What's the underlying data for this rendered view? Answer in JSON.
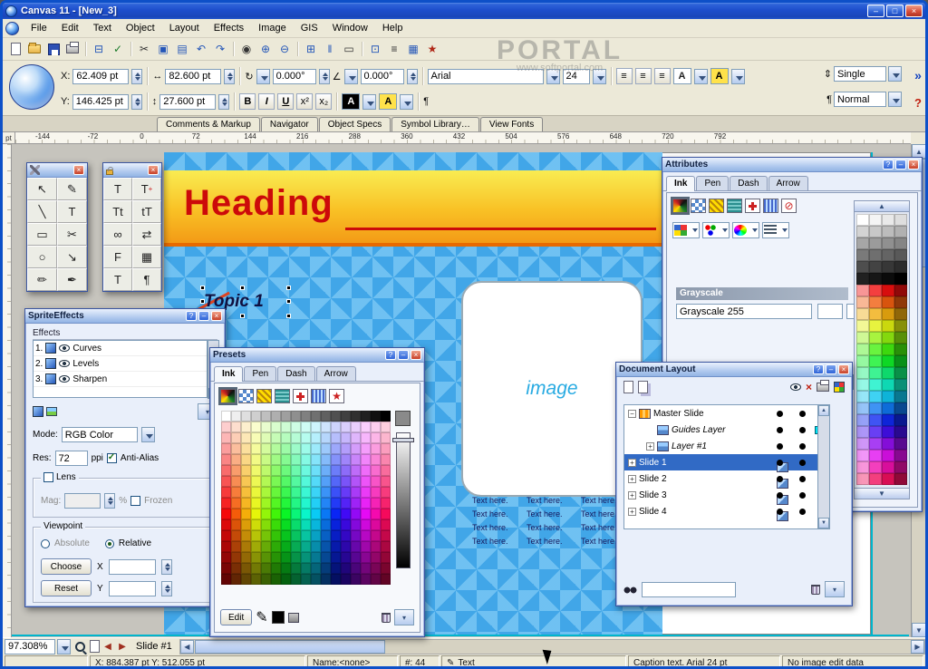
{
  "window": {
    "title": "Canvas 11 - [New_3]"
  },
  "menubar": {
    "items": [
      "File",
      "Edit",
      "Text",
      "Object",
      "Layout",
      "Effects",
      "Image",
      "GIS",
      "Window",
      "Help"
    ]
  },
  "watermark": {
    "line1": "PORTAL",
    "line2": "www.softportal.com"
  },
  "icons": {
    "dropdown": "▾",
    "left": "◀",
    "right": "▶",
    "up": "▲",
    "down": "▼",
    "help": "?",
    "close": "×",
    "minimize": "–",
    "restore": "□",
    "pen": "✎",
    "width_arrow": "↔",
    "height_arrow": "↕",
    "rotate": "↻",
    "slant": "∠",
    "chevron": "»",
    "question": "?",
    "paragraph": "¶",
    "spacing": "⇕",
    "redx": "×"
  },
  "toolbar": {
    "icons": [
      {
        "name": "new-document-icon",
        "kind": "mi-page",
        "glyph": ""
      },
      {
        "name": "open-icon",
        "kind": "mi-folder",
        "glyph": ""
      },
      {
        "name": "save-icon",
        "kind": "mi-disk",
        "glyph": ""
      },
      {
        "name": "print-icon",
        "kind": "mi-printer",
        "glyph": ""
      },
      {
        "name": "separator",
        "cls": "sep",
        "glyph": ""
      },
      {
        "name": "page-setup-icon",
        "glyph": "⊟",
        "gcls": "blue"
      },
      {
        "name": "spell-check-icon",
        "glyph": "✓",
        "gcls": "green"
      },
      {
        "name": "separator",
        "cls": "sep",
        "glyph": ""
      },
      {
        "name": "cut-icon",
        "glyph": "✂"
      },
      {
        "name": "copy-icon",
        "glyph": "▣",
        "gcls": "blue"
      },
      {
        "name": "paste-icon",
        "glyph": "▤",
        "gcls": "blue"
      },
      {
        "name": "undo-icon",
        "glyph": "↶",
        "gcls": "blue"
      },
      {
        "name": "redo-icon",
        "glyph": "↷",
        "gcls": "blue"
      },
      {
        "name": "separator",
        "cls": "sep",
        "glyph": ""
      },
      {
        "name": "find-icon",
        "glyph": "◉"
      },
      {
        "name": "zoom-in-icon",
        "glyph": "⊕",
        "gcls": "blue"
      },
      {
        "name": "zoom-out-icon",
        "glyph": "⊖",
        "gcls": "blue"
      },
      {
        "name": "separator",
        "cls": "sep",
        "glyph": ""
      },
      {
        "name": "grid-icon",
        "glyph": "⊞",
        "gcls": "blue"
      },
      {
        "name": "guides-icon",
        "glyph": "‖",
        "gcls": "blue"
      },
      {
        "name": "rulers-icon",
        "glyph": "▭"
      },
      {
        "name": "separator",
        "cls": "sep",
        "glyph": ""
      },
      {
        "name": "group-icon",
        "glyph": "⊡",
        "gcls": "blue"
      },
      {
        "name": "align-icon",
        "glyph": "≡"
      },
      {
        "name": "table-icon",
        "glyph": "▦",
        "gcls": "blue"
      },
      {
        "name": "symbol-icon",
        "glyph": "★",
        "gcls": "red"
      }
    ]
  },
  "propbar": {
    "x_label": "X:",
    "x_value": "62.409 pt",
    "y_label": "Y:",
    "y_value": "146.425 pt",
    "width_value": "82.600 pt",
    "height_value": "27.600 pt",
    "rotation_value": "0.000°",
    "skew_value": "0.000°",
    "font_family": "Arial",
    "font_size": "24",
    "bold": "B",
    "italic": "I",
    "underline": "U",
    "superscript": "x²",
    "subscript": "x₂",
    "color_letter": "A",
    "paragraph_style": "Single",
    "text_style": "Normal"
  },
  "dock_tabs": {
    "items": [
      "Comments & Markup",
      "Navigator",
      "Object Specs",
      "Symbol Library…",
      "View Fonts"
    ]
  },
  "ruler": {
    "unit_label": "pt",
    "numbers": [
      "-144",
      "-72",
      "0",
      "72",
      "144",
      "216",
      "288",
      "360",
      "432",
      "504",
      "576",
      "648",
      "720",
      "792"
    ]
  },
  "document": {
    "heading_text": "Heading",
    "topic_text": "Topic 1",
    "image_placeholder": "image",
    "body_cell": "Text here.",
    "body_cells_count": 12
  },
  "toolbox1": {
    "tools": [
      {
        "name": "select-tool",
        "glyph": "↖"
      },
      {
        "name": "pen-tool",
        "glyph": "✎"
      },
      {
        "name": "line-tool",
        "glyph": "╲"
      },
      {
        "name": "text-tool",
        "glyph": "T"
      },
      {
        "name": "rectangle-tool",
        "glyph": "▭"
      },
      {
        "name": "knife-tool",
        "glyph": "✂"
      },
      {
        "name": "ellipse-tool",
        "glyph": "○"
      },
      {
        "name": "arrow-tool",
        "glyph": "↘"
      },
      {
        "name": "pencil-tool",
        "glyph": "✏"
      },
      {
        "name": "brush-tool",
        "glyph": "✒"
      }
    ]
  },
  "toolbox2": {
    "tools": [
      {
        "name": "frame-text-tool",
        "glyph": "T"
      },
      {
        "name": "add-text-tool",
        "glyph": "T",
        "sup": "+"
      },
      {
        "name": "linked-text-tool",
        "glyph": "Tt"
      },
      {
        "name": "text-pair-tool",
        "glyph": "tT"
      },
      {
        "name": "link-frames-tool",
        "glyph": "∞"
      },
      {
        "name": "flow-arrows-tool",
        "glyph": "⇄"
      },
      {
        "name": "form-tool",
        "glyph": "F",
        "sup": ""
      },
      {
        "name": "table-tool",
        "glyph": "▦"
      },
      {
        "name": "type-tool",
        "glyph": "T"
      },
      {
        "name": "paragraph-tool",
        "glyph": "¶"
      }
    ]
  },
  "sprite_effects": {
    "title": "SpriteEffects",
    "group_label": "Effects",
    "effects": [
      {
        "num": "1.",
        "name": "Curves"
      },
      {
        "num": "2.",
        "name": "Levels"
      },
      {
        "num": "3.",
        "name": "Sharpen"
      }
    ],
    "mode_label": "Mode:",
    "mode_value": "RGB Color",
    "res_label": "Res:",
    "res_value": "72",
    "res_unit": "ppi",
    "antialias_label": "Anti-Alias",
    "lens_label": "Lens",
    "mag_label": "Mag:",
    "mag_unit": "%",
    "frozen_label": "Frozen",
    "viewpoint_label": "Viewpoint",
    "absolute_label": "Absolute",
    "relative_label": "Relative",
    "choose_label": "Choose",
    "reset_label": "Reset",
    "x_label": "X",
    "y_label": "Y"
  },
  "presets": {
    "title": "Presets",
    "tabs": [
      {
        "label": "Ink",
        "cls": "active",
        "name": "tab-ink"
      },
      {
        "label": "Pen",
        "cls": "",
        "name": "tab-pen"
      },
      {
        "label": "Dash",
        "cls": "",
        "name": "tab-dash"
      },
      {
        "label": "Arrow",
        "cls": "",
        "name": "tab-arrow"
      }
    ],
    "swatches": [
      {
        "name": "gradient-ink-swatch",
        "cls": "sw-gradient sel",
        "glyph": ""
      },
      {
        "name": "checker-ink-swatch",
        "cls": "sw-checker",
        "glyph": ""
      },
      {
        "name": "hatch-ink-swatch",
        "cls": "sw-hatch-yellow",
        "glyph": ""
      },
      {
        "name": "texture-ink-swatch",
        "cls": "sw-texture-teal",
        "glyph": ""
      },
      {
        "name": "symbol-ink-swatch",
        "cls": "sw-plus-red",
        "glyph": ""
      },
      {
        "name": "pattern-ink-swatch",
        "cls": "sw-pattern-blue",
        "glyph": ""
      },
      {
        "name": "star-ink-swatch",
        "cls": "sw-star-red",
        "glyph": "★"
      }
    ],
    "edit_label": "Edit"
  },
  "attributes": {
    "title": "Attributes",
    "tabs": [
      {
        "label": "Ink",
        "cls": "active",
        "name": "tab-ink"
      },
      {
        "label": "Pen",
        "cls": "",
        "name": "tab-pen"
      },
      {
        "label": "Dash",
        "cls": "",
        "name": "tab-dash"
      },
      {
        "label": "Arrow",
        "cls": "",
        "name": "tab-arrow"
      }
    ],
    "swatches": [
      {
        "name": "gradient-ink-swatch",
        "cls": "sw-gradient sel",
        "glyph": ""
      },
      {
        "name": "checker-ink-swatch",
        "cls": "sw-checker",
        "glyph": ""
      },
      {
        "name": "hatch-ink-swatch",
        "cls": "sw-hatch-yellow",
        "glyph": ""
      },
      {
        "name": "texture-ink-swatch",
        "cls": "sw-texture-teal",
        "glyph": ""
      },
      {
        "name": "symbol-ink-swatch",
        "cls": "sw-plus-red",
        "glyph": ""
      },
      {
        "name": "pattern-ink-swatch",
        "cls": "sw-pattern-blue",
        "glyph": ""
      },
      {
        "name": "none-ink-swatch",
        "cls": "sw-none",
        "glyph": "⊘"
      }
    ],
    "mode_header": "Grayscale",
    "value_field": "Grayscale 255",
    "slider_value": "255"
  },
  "doc_layout": {
    "title": "Document Layout",
    "rows": [
      {
        "label": "Master Slide",
        "cls": "",
        "icon": "master",
        "exp": "−"
      },
      {
        "label": "Guides Layer",
        "cls": "ital ind1",
        "icon": "layer",
        "exp": "",
        "swatch_style": "background:#00E0F0"
      },
      {
        "label": "Layer #1",
        "cls": "ital ind1",
        "icon": "layer",
        "exp": "+"
      },
      {
        "label": "Slide 1",
        "cls": "sel",
        "icon": "slide",
        "exp": "+"
      },
      {
        "label": "Slide 2",
        "cls": "",
        "icon": "slide",
        "exp": "+"
      },
      {
        "label": "Slide 3",
        "cls": "",
        "icon": "slide",
        "exp": "+"
      },
      {
        "label": "Slide 4",
        "cls": "",
        "icon": "slide",
        "exp": "+"
      }
    ]
  },
  "bottombar": {
    "zoom_value": "97.308%",
    "slide_label": "Slide #1"
  },
  "statusbar": {
    "coords": "X: 884.387 pt Y: 512.055 pt",
    "name": "Name:<none>",
    "count": "#: 44",
    "tool": "Text",
    "caption": "Caption text. Arial 24 pt",
    "image_edit": "No image edit data"
  },
  "colors": {
    "selection": "#316AC5",
    "slide_blue": "#41A6E8",
    "heading_red": "#CC0A0A",
    "accent_cyan": "#00B5CC",
    "guides_swatch": "#00E0F0"
  }
}
